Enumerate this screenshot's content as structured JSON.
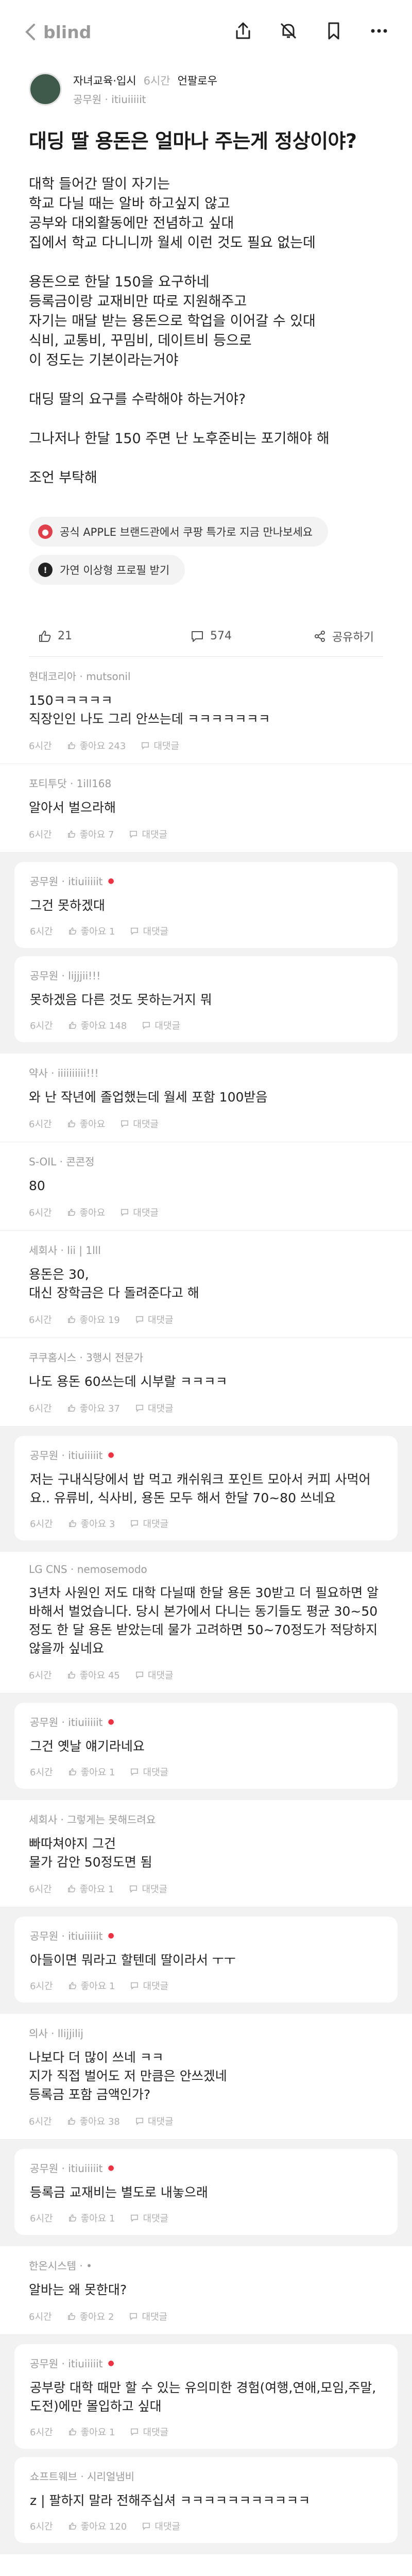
{
  "nav": {
    "back_label": "blind"
  },
  "author": {
    "board": "자녀교육·입시",
    "time": "6시간",
    "views": "언팔로우",
    "company": "공무원 · itiuiiiiit"
  },
  "post": {
    "title": "대딩 딸 용돈은 얼마나 주는게 정상이야?",
    "paragraphs": [
      [
        "대학 들어간 딸이 자기는",
        "학교 다닐 때는 알바 하고싶지 않고",
        "공부와 대외활동에만 전념하고 싶대",
        "집에서 학교 다니니까 월세 이런 것도 필요 없는데"
      ],
      [
        "용돈으로 한달 150을 요구하네",
        "등록금이랑 교재비만 따로 지원해주고",
        "자기는 매달 받는 용돈으로 학업을 이어갈 수 있대",
        "식비, 교통비, 꾸밈비, 데이트비 등으로",
        "이 정도는 기본이라는거야"
      ],
      [
        "대딩 딸의 요구를 수락해야 하는거야?"
      ],
      [
        "그나저나 한달 150 주면 난 노후준비는 포기해야 해"
      ],
      [
        "조언 부탁해"
      ]
    ]
  },
  "chips": [
    {
      "label": "공식 APPLE 브랜드관에서 쿠팡 특가로 지금 만나보세요",
      "color": "#e0404c",
      "icon": "apple-store-icon"
    },
    {
      "label": "가연 이상형 프로필 받기",
      "color": "#222222",
      "icon": "info-icon"
    }
  ],
  "stats": {
    "likes": "21",
    "comments": "574",
    "share": "공유하기"
  },
  "foot_labels": {
    "like": "좋아요",
    "reply": "대댓글"
  },
  "comments": [
    {
      "meta": "현대코리아 · mutsonil",
      "text": "150ㅋㅋㅋㅋㅋ\n직장인인 나도 그리 안쓰는데 ㅋㅋㅋㅋㅋㅋㅋ",
      "time": "6시간",
      "likes": "좋아요 243",
      "replies": []
    },
    {
      "meta": "포티투닷 · 1ill168",
      "text": "알아서 벌으라해",
      "time": "6시간",
      "likes": "좋아요 7",
      "replies": [
        {
          "meta": "공무원 · itiuiiiiit",
          "op": true,
          "text": "그건 못하겠대",
          "time": "6시간",
          "likes": "좋아요 1"
        },
        {
          "meta": "공무원 · lijjjii!!!",
          "op": false,
          "text": "못하겠음 다른 것도 못하는거지 뭐",
          "time": "6시간",
          "likes": "좋아요 148"
        }
      ]
    },
    {
      "meta": "약사 · iiiiiiiiii!!!",
      "text": "와 난 작년에 졸업했는데 월세 포함 100받음",
      "time": "6시간",
      "likes": "좋아요",
      "replies": []
    },
    {
      "meta": "S-OIL · 콘콘정",
      "text": "80",
      "time": "6시간",
      "likes": "좋아요",
      "replies": []
    },
    {
      "meta": "세회사 · lii | 1lll",
      "text": "용돈은 30,\n대신 장학금은 다 돌려준다고 해",
      "time": "6시간",
      "likes": "좋아요 19",
      "replies": []
    },
    {
      "meta": "쿠쿠홈시스 · 3행시 전문가",
      "text": "나도 용돈 60쓰는데 시부랄 ㅋㅋㅋㅋ",
      "time": "6시간",
      "likes": "좋아요 37",
      "replies": [
        {
          "meta": "공무원 · itiuiiiiit",
          "op": true,
          "text": "저는 구내식당에서 밥 먹고 캐쉬워크 포인트 모아서 커피 사먹어요.. 유류비, 식사비, 용돈 모두 해서 한달 70~80 쓰네요",
          "time": "6시간",
          "likes": "좋아요 3"
        }
      ]
    },
    {
      "meta": "LG CNS · nemosemodo",
      "text": "3년차 사원인 저도 대학 다닐때 한달 용돈 30받고 더 필요하면 알바해서 벌었습니다. 당시 본가에서 다니는 동기들도 평균 30~50정도 한 달 용돈 받았는데 물가 고려하면 50~70정도가 적당하지 않을까 싶네요",
      "time": "6시간",
      "likes": "좋아요 45",
      "replies": [
        {
          "meta": "공무원 · itiuiiiiit",
          "op": true,
          "text": "그건 옛날 얘기라네요",
          "time": "6시간",
          "likes": "좋아요 1"
        }
      ]
    },
    {
      "meta": "세회사 · 그렇게는 못해드려요",
      "text": "빠따쳐야지 그건\n물가 감안 50정도면 됨",
      "time": "6시간",
      "likes": "좋아요 1",
      "replies": [
        {
          "meta": "공무원 · itiuiiiiit",
          "op": true,
          "text": "아들이면 뭐라고 할텐데 딸이라서 ㅜㅜ",
          "time": "6시간",
          "likes": "좋아요 1"
        }
      ]
    },
    {
      "meta": "의사 · llijjilij",
      "text": "나보다 더 많이 쓰네 ㅋㅋ\n지가 직접 벌어도 저 만큼은 안쓰겠네\n등록금 포함 금액인가?",
      "time": "6시간",
      "likes": "좋아요 38",
      "replies": [
        {
          "meta": "공무원 · itiuiiiiit",
          "op": true,
          "text": "등록금 교재비는 별도로 내놓으래",
          "time": "6시간",
          "likes": "좋아요 1"
        }
      ]
    },
    {
      "meta": "한온시스템 · •",
      "text": "알바는 왜 못한대?",
      "time": "6시간",
      "likes": "좋아요 2",
      "replies": [
        {
          "meta": "공무원 · itiuiiiiit",
          "op": true,
          "text": "공부랑 대학 때만 할 수 있는 유의미한 경험(여행,연애,모임,주말,도전)에만 몰입하고 싶대",
          "time": "6시간",
          "likes": "좋아요 1"
        },
        {
          "meta": "쇼프트웨브 · 시리얼냄비",
          "op": false,
          "text": "z | 팔하지 말라 전해주십셔 ㅋㅋㅋㅋㅋㅋㅋㅋㅋㅋㅋ",
          "time": "6시간",
          "likes": "좋아요 120"
        }
      ]
    }
  ]
}
